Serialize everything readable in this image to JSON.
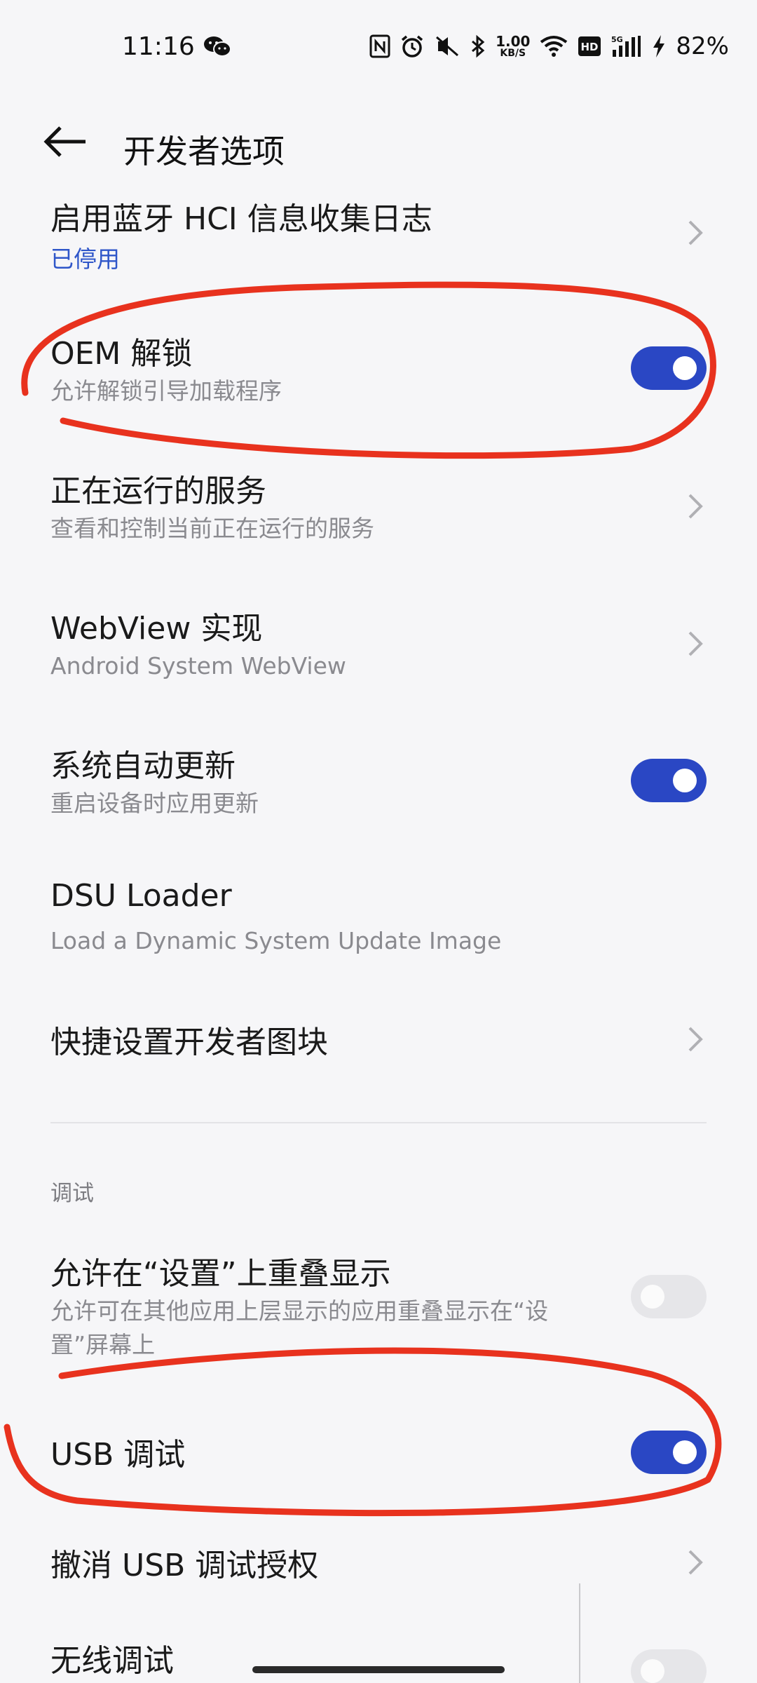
{
  "status_bar": {
    "time": "11:16",
    "speed_value": "1.00",
    "speed_unit": "KB/S",
    "battery": "82%",
    "icons": [
      "wechat-icon",
      "nfc-icon",
      "alarm-icon",
      "mute-icon",
      "bluetooth-icon",
      "wifi-icon",
      "hd-icon",
      "5g-signal-icon",
      "charging-icon"
    ]
  },
  "header": {
    "title": "开发者选项"
  },
  "items": [
    {
      "title": "启用蓝牙 HCI 信息收集日志",
      "subtitle": "已停用",
      "control": "chevron"
    },
    {
      "title": "OEM 解锁",
      "subtitle": "允许解锁引导加载程序",
      "control": "toggle",
      "on": true
    },
    {
      "title": "正在运行的服务",
      "subtitle": "查看和控制当前正在运行的服务",
      "control": "chevron"
    },
    {
      "title": "WebView 实现",
      "subtitle": "Android System WebView",
      "control": "chevron"
    },
    {
      "title": "系统自动更新",
      "subtitle": "重启设备时应用更新",
      "control": "toggle",
      "on": true
    },
    {
      "title": "DSU Loader",
      "subtitle": "Load a Dynamic System Update Image",
      "control": "none"
    },
    {
      "title": "快捷设置开发者图块",
      "control": "chevron"
    }
  ],
  "section_debug": "调试",
  "debug_items": [
    {
      "title": "允许在“设置”上重叠显示",
      "subtitle": "允许可在其他应用上层显示的应用重叠显示在“设置”屏幕上",
      "control": "toggle",
      "on": false
    },
    {
      "title": "USB 调试",
      "control": "toggle",
      "on": true
    },
    {
      "title": "撤消 USB 调试授权",
      "control": "chevron"
    },
    {
      "title": "无线调试",
      "control": "toggle",
      "on": false
    }
  ],
  "colors": {
    "accent": "#2a47c4",
    "annotation": "#e8321e",
    "subtitle_blue": "#2f56c9"
  }
}
